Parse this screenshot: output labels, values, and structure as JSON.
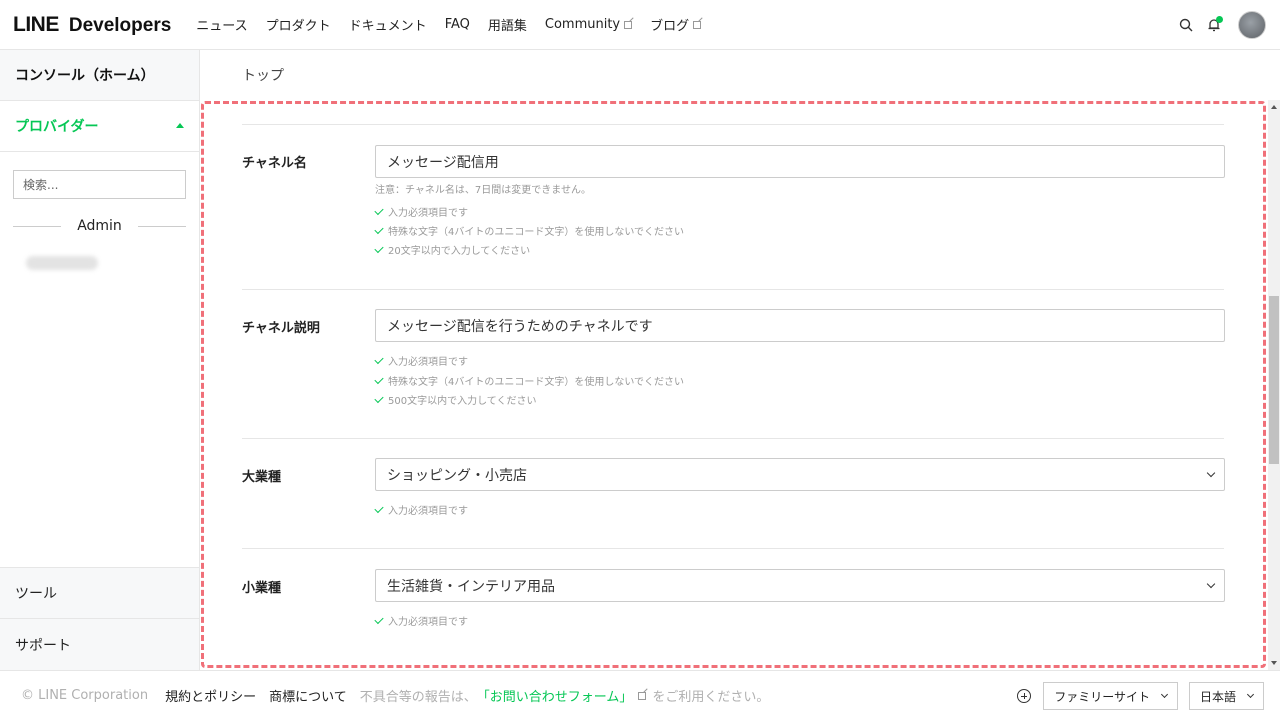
{
  "header": {
    "logo_line": "LINE",
    "logo_developers": "Developers",
    "nav": [
      {
        "label": "ニュース",
        "external": false
      },
      {
        "label": "プロダクト",
        "external": false
      },
      {
        "label": "ドキュメント",
        "external": false
      },
      {
        "label": "FAQ",
        "external": false
      },
      {
        "label": "用語集",
        "external": false
      },
      {
        "label": "Community",
        "external": true
      },
      {
        "label": "ブログ",
        "external": true
      }
    ],
    "icons": [
      "search-icon",
      "bell-icon",
      "avatar"
    ]
  },
  "sidebar": {
    "home": "コンソール（ホーム）",
    "provider": "プロバイダー",
    "search_placeholder": "検索...",
    "section": "Admin",
    "tools": "ツール",
    "support": "サポート"
  },
  "main": {
    "breadcrumb": "トップ",
    "fields": [
      {
        "label": "チャネル名",
        "type": "input",
        "value": "メッセージ配信用",
        "note": "注意：チャネル名は、7日間は変更できません。",
        "checks": [
          "入力必須項目です",
          "特殊な文字（4バイトのユニコード文字）を使用しないでください",
          "20文字以内で入力してください"
        ]
      },
      {
        "label": "チャネル説明",
        "type": "input",
        "value": "メッセージ配信を行うためのチャネルです",
        "checks": [
          "入力必須項目です",
          "特殊な文字（4バイトのユニコード文字）を使用しないでください",
          "500文字以内で入力してください"
        ]
      },
      {
        "label": "大業種",
        "type": "select",
        "value": "ショッピング・小売店",
        "checks": [
          "入力必須項目です"
        ]
      },
      {
        "label": "小業種",
        "type": "select",
        "value": "生活雑貨・インテリア用品",
        "checks": [
          "入力必須項目です"
        ]
      }
    ]
  },
  "footer": {
    "copyright": "© LINE Corporation",
    "terms": "規約とポリシー",
    "trademark": "商標について",
    "report_prefix": "不具合等の報告は、",
    "report_link": "「お問い合わせフォーム」",
    "report_suffix": "をご利用ください。",
    "family": "ファミリーサイト",
    "language": "日本語"
  },
  "colors": {
    "accent": "#06c755",
    "highlight_border": "#f07079"
  }
}
